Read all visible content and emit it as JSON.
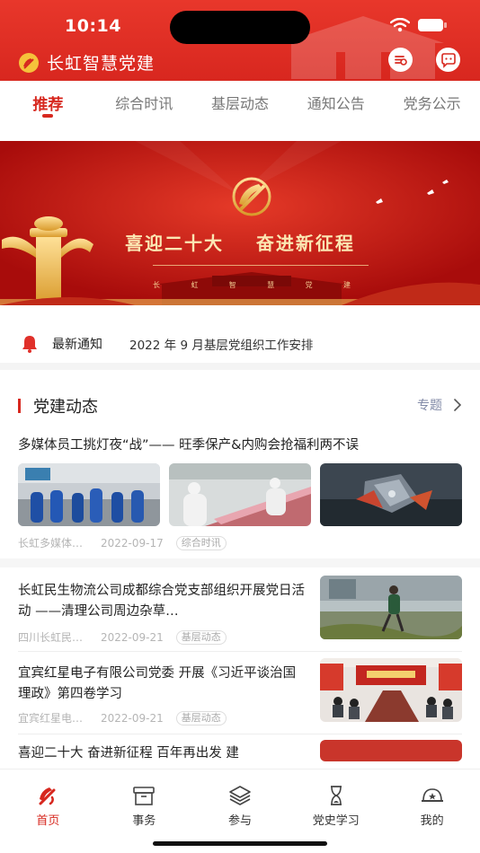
{
  "status_bar": {
    "time": "10:14"
  },
  "header": {
    "title": "长虹智慧党建",
    "icons": [
      "party-emblem-icon",
      "search-icon",
      "message-icon"
    ]
  },
  "tabs": [
    {
      "label": "推荐",
      "active": true
    },
    {
      "label": "综合时讯"
    },
    {
      "label": "基层动态"
    },
    {
      "label": "通知公告"
    },
    {
      "label": "党务公示"
    }
  ],
  "banner": {
    "title": "喜迎二十大    奋进新征程",
    "sub": [
      "长",
      "虹",
      "智",
      "慧",
      "党",
      "建"
    ]
  },
  "notice": {
    "label": "最新通知",
    "text": "2022 年 9 月基层党组织工作安排",
    "icon": "bell-icon"
  },
  "section": {
    "title": "党建动态",
    "more": "专题",
    "more_icon": "chevron-right-icon"
  },
  "news": [
    {
      "title": "多媒体员工挑灯夜“战”—— 旺季保产&内购会抢福利两不误",
      "source": "长虹多媒体…",
      "date": "2022-09-17",
      "tag": "综合时讯"
    },
    {
      "title": "长虹民生物流公司成都综合党支部组织开展党日活动 ——清理公司周边杂草…",
      "source": "四川长虹民…",
      "date": "2022-09-21",
      "tag": "基层动态"
    },
    {
      "title": "宜宾红星电子有限公司党委 开展《习近平谈治国理政》第四卷学习",
      "source": "宜宾红星电…",
      "date": "2022-09-21",
      "tag": "基层动态"
    },
    {
      "title": "喜迎二十大 奋进新征程 百年再出发 建"
    }
  ],
  "bottom_nav": [
    {
      "label": "首页",
      "icon": "party-emblem-icon",
      "active": true
    },
    {
      "label": "事务",
      "icon": "archive-box-icon"
    },
    {
      "label": "参与",
      "icon": "layers-icon"
    },
    {
      "label": "党史学习",
      "icon": "hourglass-icon"
    },
    {
      "label": "我的",
      "icon": "party-cap-icon"
    }
  ],
  "colors": {
    "primary": "#d7281f",
    "header": "#e0302a",
    "muted": "#b5b5b5",
    "link": "#8089a6"
  }
}
